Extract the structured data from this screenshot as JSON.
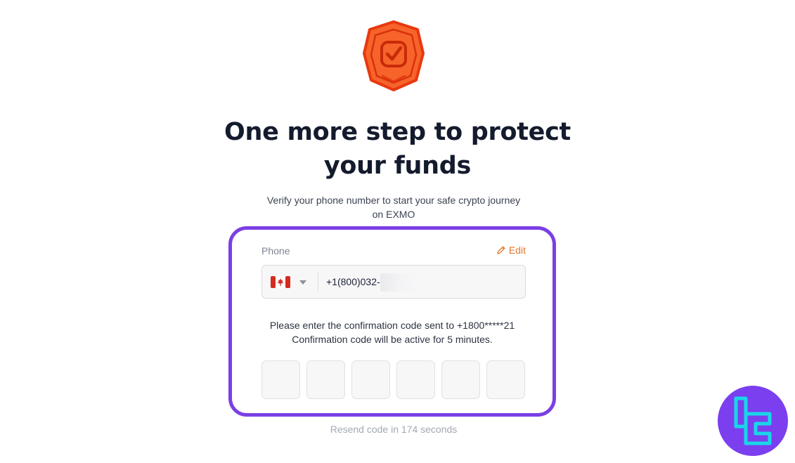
{
  "logo": {
    "icon": "shield-check-icon",
    "color": "#fb5a24"
  },
  "heading": {
    "line1": "One more step to protect",
    "line2": "your funds"
  },
  "subtitle": {
    "line1": "Verify your phone number to start your safe crypto journey",
    "line2": "on EXMO"
  },
  "card": {
    "border_color": "#7b3fe4",
    "phone_label": "Phone",
    "edit_label": "Edit",
    "edit_icon": "pencil-icon",
    "country_flag": "canada-flag-icon",
    "phone_value": "+1(800)032-3",
    "code_info_line1": "Please enter the confirmation code sent to +1800*****21",
    "code_info_line2": "Confirmation code will be active for 5 minutes.",
    "code_digits": [
      "",
      "",
      "",
      "",
      "",
      ""
    ]
  },
  "resend_text": "Resend code in 174 seconds",
  "watermark": {
    "icon": "tc-logo-icon",
    "color": "#7b3ff0"
  }
}
